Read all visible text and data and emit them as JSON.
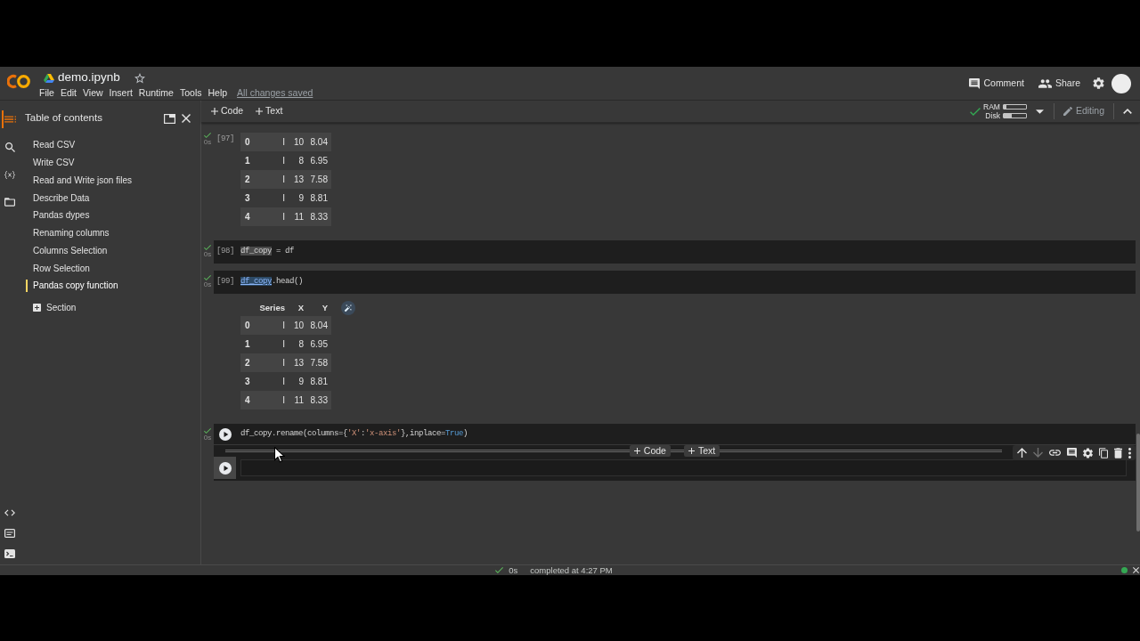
{
  "header": {
    "title": "demo.ipynb",
    "starred": false,
    "menu": [
      "File",
      "Edit",
      "View",
      "Insert",
      "Runtime",
      "Tools",
      "Help"
    ],
    "save_status": "All changes saved",
    "actions": [
      {
        "kind": "comment",
        "label": "Comment"
      },
      {
        "kind": "share",
        "label": "Share"
      }
    ]
  },
  "toolbar": {
    "insert": [
      {
        "label": "Code"
      },
      {
        "label": "Text"
      }
    ],
    "runtime": {
      "connected": true,
      "meters": [
        {
          "label": "RAM",
          "level": 0.12
        },
        {
          "label": "Disk",
          "level": 0.35
        }
      ]
    },
    "mode": "Editing"
  },
  "sidebar": {
    "panels": [
      {
        "kind": "contents",
        "selected": true
      },
      {
        "kind": "search",
        "selected": false
      },
      {
        "kind": "variables",
        "selected": false
      },
      {
        "kind": "files",
        "selected": false
      }
    ],
    "tools": [
      {
        "kind": "snippets"
      },
      {
        "kind": "palette"
      },
      {
        "kind": "terminal"
      }
    ],
    "title": "Table of contents",
    "items": [
      {
        "label": "Read CSV",
        "selected": false
      },
      {
        "label": "Write CSV",
        "selected": false
      },
      {
        "label": "Read and Write json files",
        "selected": false
      },
      {
        "label": "Describe Data",
        "selected": false
      },
      {
        "label": "Pandas dypes",
        "selected": false
      },
      {
        "label": "Renaming columns",
        "selected": false
      },
      {
        "label": "Columns Selection",
        "selected": false
      },
      {
        "label": "Row Selection",
        "selected": false
      },
      {
        "label": "Pandas copy function",
        "selected": true
      }
    ],
    "add_section": "Section"
  },
  "cells": [
    {
      "execution_count": "[97]",
      "executed": true,
      "run_time": "0s",
      "output": {
        "rows": [
          [
            "0",
            "I",
            "10",
            "8.04"
          ],
          [
            "1",
            "I",
            "8",
            "6.95"
          ],
          [
            "2",
            "I",
            "13",
            "7.58"
          ],
          [
            "3",
            "I",
            "9",
            "8.81"
          ],
          [
            "4",
            "I",
            "11",
            "8.33"
          ]
        ]
      }
    },
    {
      "execution_count": "[98]",
      "executed": true,
      "run_time": "0s",
      "code": [
        {
          "text": "df_copy",
          "kind": "occurrence"
        },
        {
          "text": " = df",
          "kind": "plain"
        }
      ]
    },
    {
      "execution_count": "[99]",
      "executed": true,
      "run_time": "0s",
      "code": [
        {
          "text": "df_copy",
          "kind": "reference"
        },
        {
          "text": ".head()",
          "kind": "plain"
        }
      ],
      "output": {
        "columns": [
          "",
          "Series",
          "X",
          "Y"
        ],
        "rows": [
          [
            "0",
            "I",
            "10",
            "8.04"
          ],
          [
            "1",
            "I",
            "8",
            "6.95"
          ],
          [
            "2",
            "I",
            "13",
            "7.58"
          ],
          [
            "3",
            "I",
            "9",
            "8.81"
          ],
          [
            "4",
            "I",
            "11",
            "8.33"
          ]
        ]
      }
    },
    {
      "executed": true,
      "run_time": "0s",
      "code": [
        {
          "text": "df_copy.rename(columns={",
          "kind": "plain"
        },
        {
          "text": "'X'",
          "kind": "string"
        },
        {
          "text": ":",
          "kind": "plain"
        },
        {
          "text": "'x-axis'",
          "kind": "string"
        },
        {
          "text": "},inplace=",
          "kind": "plain"
        },
        {
          "text": "True",
          "kind": "keyword"
        },
        {
          "text": ")",
          "kind": "plain"
        }
      ]
    },
    {
      "focused": true,
      "insert_above": [
        {
          "label": "Code"
        },
        {
          "label": "Text"
        }
      ],
      "toolbar": [
        {
          "kind": "up",
          "disabled": false
        },
        {
          "kind": "down",
          "disabled": true
        },
        {
          "kind": "link",
          "disabled": false
        },
        {
          "kind": "comment",
          "disabled": false
        },
        {
          "kind": "settings",
          "disabled": false
        },
        {
          "kind": "mirror",
          "disabled": false
        },
        {
          "kind": "delete",
          "disabled": false
        },
        {
          "kind": "more",
          "disabled": false
        }
      ]
    }
  ],
  "status_bar": {
    "succeeded": true,
    "run_time": "0s",
    "message": "completed at 4:27 PM",
    "connected": true
  }
}
